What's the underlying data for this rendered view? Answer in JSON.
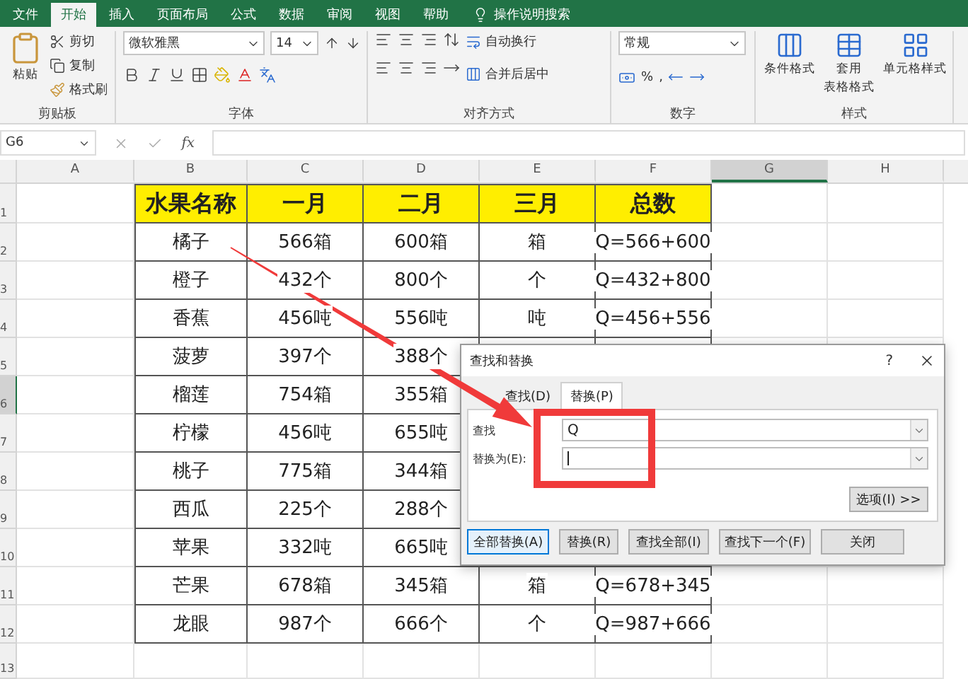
{
  "ribbon_tabs": [
    {
      "label": "文件",
      "selected": false
    },
    {
      "label": "开始",
      "selected": true
    },
    {
      "label": "插入",
      "selected": false
    },
    {
      "label": "页面布局",
      "selected": false
    },
    {
      "label": "公式",
      "selected": false
    },
    {
      "label": "数据",
      "selected": false
    },
    {
      "label": "审阅",
      "selected": false
    },
    {
      "label": "视图",
      "selected": false
    },
    {
      "label": "帮助",
      "selected": false
    }
  ],
  "tell_me": "操作说明搜索",
  "clipboard": {
    "paste": "粘贴",
    "cut": "剪切",
    "copy": "复制",
    "format_painter": "格式刷",
    "label": "剪贴板"
  },
  "font": {
    "name": "微软雅黑",
    "size": "14",
    "label": "字体"
  },
  "alignment": {
    "wrap_text": "自动换行",
    "merge_center": "合并后居中",
    "label": "对齐方式"
  },
  "number": {
    "format": "常规",
    "percent": "%",
    "comma": ",",
    "label": "数字"
  },
  "styles": {
    "buttons": [
      {
        "lines": [
          "条件格式"
        ]
      },
      {
        "lines": [
          "套用",
          "表格格式"
        ]
      },
      {
        "lines": [
          "单元格样式"
        ]
      }
    ],
    "label": "样式"
  },
  "formula_bar": {
    "name_box": "G6",
    "fx": "fx"
  },
  "columns": [
    {
      "label": "A",
      "selected": false
    },
    {
      "label": "B",
      "selected": false
    },
    {
      "label": "C",
      "selected": false
    },
    {
      "label": "D",
      "selected": false
    },
    {
      "label": "E",
      "selected": false
    },
    {
      "label": "F",
      "selected": false
    },
    {
      "label": "G",
      "selected": true
    },
    {
      "label": "H",
      "selected": false
    }
  ],
  "rows": [
    {
      "number": "1",
      "selected": false,
      "kind": "header",
      "cells": [
        "水果名称",
        "一月",
        "二月",
        "三月",
        "总数"
      ]
    },
    {
      "number": "2",
      "selected": false,
      "kind": "data",
      "cells": [
        "橘子",
        "566箱",
        "600箱",
        "箱",
        "Q=566+600"
      ]
    },
    {
      "number": "3",
      "selected": false,
      "kind": "data",
      "cells": [
        "橙子",
        "432个",
        "800个",
        "个",
        "Q=432+800"
      ]
    },
    {
      "number": "4",
      "selected": false,
      "kind": "data",
      "cells": [
        "香蕉",
        "456吨",
        "556吨",
        "吨",
        "Q=456+556"
      ]
    },
    {
      "number": "5",
      "selected": false,
      "kind": "data",
      "cells": [
        "菠萝",
        "397个",
        "388个"
      ]
    },
    {
      "number": "6",
      "selected": true,
      "kind": "data",
      "cells": [
        "榴莲",
        "754箱",
        "355箱"
      ]
    },
    {
      "number": "7",
      "selected": false,
      "kind": "data",
      "cells": [
        "柠檬",
        "456吨",
        "655吨"
      ]
    },
    {
      "number": "8",
      "selected": false,
      "kind": "data",
      "cells": [
        "桃子",
        "775箱",
        "344箱"
      ]
    },
    {
      "number": "9",
      "selected": false,
      "kind": "data",
      "cells": [
        "西瓜",
        "225个",
        "288个"
      ]
    },
    {
      "number": "10",
      "selected": false,
      "kind": "data",
      "cells": [
        "苹果",
        "332吨",
        "665吨"
      ]
    },
    {
      "number": "11",
      "selected": false,
      "kind": "data",
      "cells": [
        "芒果",
        "678箱",
        "345箱",
        "箱",
        "Q=678+345"
      ]
    },
    {
      "number": "12",
      "selected": false,
      "kind": "data",
      "cells": [
        "龙眼",
        "987个",
        "666个",
        "个",
        "Q=987+666"
      ]
    },
    {
      "number": "13",
      "selected": false,
      "kind": "empty"
    }
  ],
  "dialog": {
    "title": "查找和替换",
    "help": "?",
    "tabs": [
      {
        "label": "查找(D)",
        "selected": false
      },
      {
        "label": "替换(P)",
        "selected": true
      }
    ],
    "find_label": "查找",
    "find_value": "Q",
    "replace_label": "替换为(E):",
    "options_button": "选项(I) >>",
    "buttons": [
      {
        "label": "全部替换(A)",
        "focused": true
      },
      {
        "label": "替换(R)",
        "focused": false
      },
      {
        "label": "查找全部(I)",
        "focused": false
      },
      {
        "label": "查找下一个(F)",
        "focused": false
      },
      {
        "label": "关闭",
        "focused": false
      }
    ]
  }
}
